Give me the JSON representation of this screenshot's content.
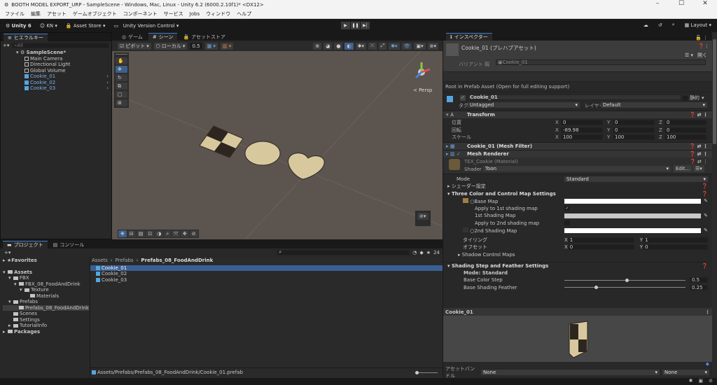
{
  "window": {
    "title": "BOOTH MODEL EXPORT_URP - SampleScene - Windows, Mac, Linux - Unity 6.2 (6000.2.10f1)* <DX12>",
    "controls": [
      "–",
      "☐",
      "✕"
    ]
  },
  "menu": [
    "ファイル",
    "編集",
    "アセット",
    "ゲームオブジェクト",
    "コンポーネント",
    "サービス",
    "Jobs",
    "ウィンドウ",
    "ヘルプ"
  ],
  "toolbar": {
    "unity": "Unity 6",
    "account": "KN",
    "asset_store": "Asset Store",
    "version_control": "Unity Version Control",
    "layout": "Layout"
  },
  "hierarchy": {
    "tab": "ヒエラルキー",
    "search_placeholder": "All",
    "scene": "SampleScene*",
    "items": [
      {
        "label": "Main Camera",
        "prefab": false
      },
      {
        "label": "Directional Light",
        "prefab": false
      },
      {
        "label": "Global Volume",
        "prefab": false
      },
      {
        "label": "Cookie_01",
        "prefab": true
      },
      {
        "label": "Cookie_02",
        "prefab": true
      },
      {
        "label": "Cookie_03",
        "prefab": true
      }
    ]
  },
  "scene": {
    "tabs": [
      "ゲーム",
      "シーン",
      "アセットストア"
    ],
    "active_tab": 1,
    "pivot": "ピボット",
    "local": "ローカル",
    "snap": "0.5",
    "persp": "< Persp"
  },
  "project": {
    "tabs": [
      "プロジェクト",
      "コンソール"
    ],
    "count": "24",
    "favorites": "Favorites",
    "tree": [
      {
        "label": "Assets",
        "depth": 0,
        "bold": true
      },
      {
        "label": "FBX",
        "depth": 1
      },
      {
        "label": "FBX_08_FoodAndDrink",
        "depth": 2
      },
      {
        "label": "Texture",
        "depth": 3
      },
      {
        "label": "Materials",
        "depth": 4
      },
      {
        "label": "Prefabs",
        "depth": 1
      },
      {
        "label": "Prefabs_08_FoodAndDrink",
        "depth": 2,
        "selected": true
      },
      {
        "label": "Scenes",
        "depth": 1
      },
      {
        "label": "Settings",
        "depth": 1
      },
      {
        "label": "TutorialInfo",
        "depth": 1
      },
      {
        "label": "Packages",
        "depth": 0,
        "bold": true
      }
    ],
    "breadcrumb": [
      "Assets",
      "Prefabs",
      "Prefabs_08_FoodAndDrink"
    ],
    "files": [
      "Cookie_01",
      "Cookie_02",
      "Cookie_03"
    ],
    "selected_file": 0,
    "path": "Assets/Prefabs/Prefabs_08_FoodAndDrink/Cookie_01.prefab"
  },
  "inspector": {
    "tab": "インスペクター",
    "asset_title": "Cookie_01 (プレハブアセット)",
    "open_btn": "開く",
    "variant_label": "バリアント 親",
    "variant_value": "Cookie_01",
    "root_note": "Root in Prefab Asset (Open for full editing support)",
    "object_name": "Cookie_01",
    "static": "静的",
    "tag_label": "タグ",
    "tag": "Untagged",
    "layer_label": "レイヤー",
    "layer": "Default",
    "transform": {
      "title": "Transform",
      "rows": [
        {
          "label": "位置",
          "x": "0",
          "y": "0",
          "z": "0"
        },
        {
          "label": "回転",
          "x": "-89.98",
          "y": "0",
          "z": "0"
        },
        {
          "label": "スケール",
          "x": "100",
          "y": "100",
          "z": "100"
        }
      ]
    },
    "mesh_filter": "Cookie_01 (Mesh Filter)",
    "mesh_renderer": "Mesh Renderer",
    "material": {
      "name": "TEX_Cookie (Material)",
      "shader_label": "Shader",
      "shader": "Toon",
      "edit": "Edit...",
      "mode_label": "Mode",
      "mode": "Standard",
      "shader_settings": "シェーダー設定",
      "three_color": "Three Color and Control Map Settings",
      "base_map": "Base Map",
      "apply1": "Apply to 1st shading map",
      "apply1_checked": true,
      "shading1": "1st Shading Map",
      "apply2": "Apply to 2nd shading map",
      "apply2_checked": false,
      "shading2": "2nd Shading Map",
      "tiling": "タイリング",
      "offset": "オフセット",
      "tiling_x": "1",
      "tiling_y": "1",
      "offset_x": "0",
      "offset_y": "0",
      "shadow_maps": "Shadow Control Maps",
      "step_title": "Shading Step and Feather Settings",
      "step_mode": "Mode: Standard",
      "base_step": "Base Color Step",
      "base_step_value": "0.5",
      "feather": "Base Shading Feather",
      "feather_value": "0.25"
    },
    "preview_title": "Cookie_01",
    "bundle_label": "アセットバンドル",
    "bundle": "None",
    "variant": "None"
  }
}
